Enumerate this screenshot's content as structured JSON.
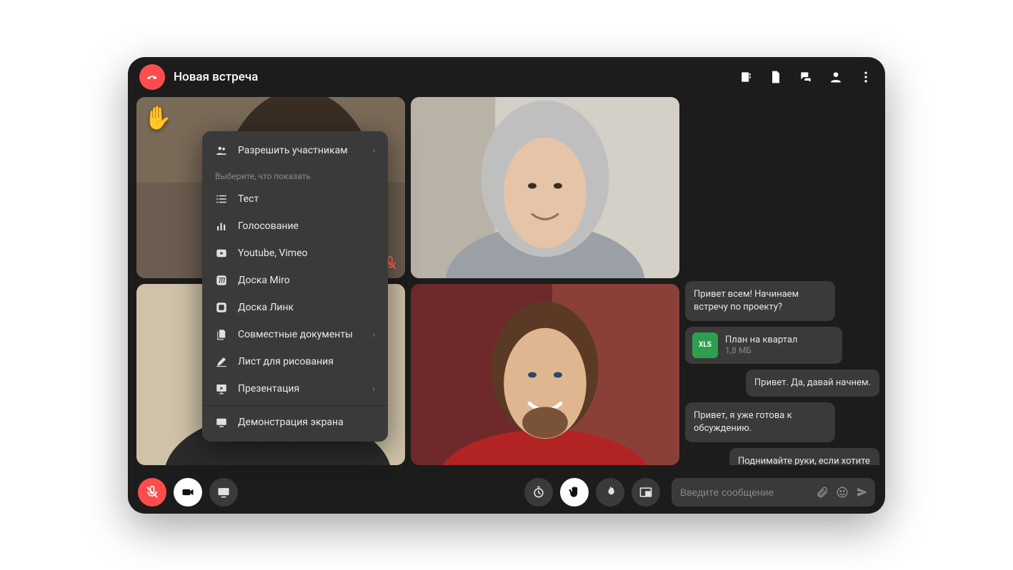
{
  "header": {
    "title": "Новая встреча"
  },
  "tiles": {
    "hand_emoji": "✋"
  },
  "popup": {
    "allow_participants": "Разрешить участникам",
    "section_label": "Выберите, что показать",
    "items": [
      {
        "label": "Тест"
      },
      {
        "label": "Голосование"
      },
      {
        "label": "Youtube, Vimeo"
      },
      {
        "label": "Доска Miro"
      },
      {
        "label": "Доска Линк"
      },
      {
        "label": "Совместные документы"
      },
      {
        "label": "Лист для рисования"
      },
      {
        "label": "Презентация"
      },
      {
        "label": "Демонстрация экрана"
      }
    ]
  },
  "chat": {
    "messages": {
      "m0": "Привет всем! Начинаем встречу по проекту?",
      "m2": "Привет. Да, давай начнем.",
      "m3": "Привет, я уже готова к обсуждению.",
      "m4": "Поднимайте руки, если хотите что-то спросить."
    },
    "file": {
      "badge": "XLS",
      "name": "План на квартал",
      "size": "1,8 МБ"
    },
    "input_placeholder": "Введите сообщение"
  }
}
